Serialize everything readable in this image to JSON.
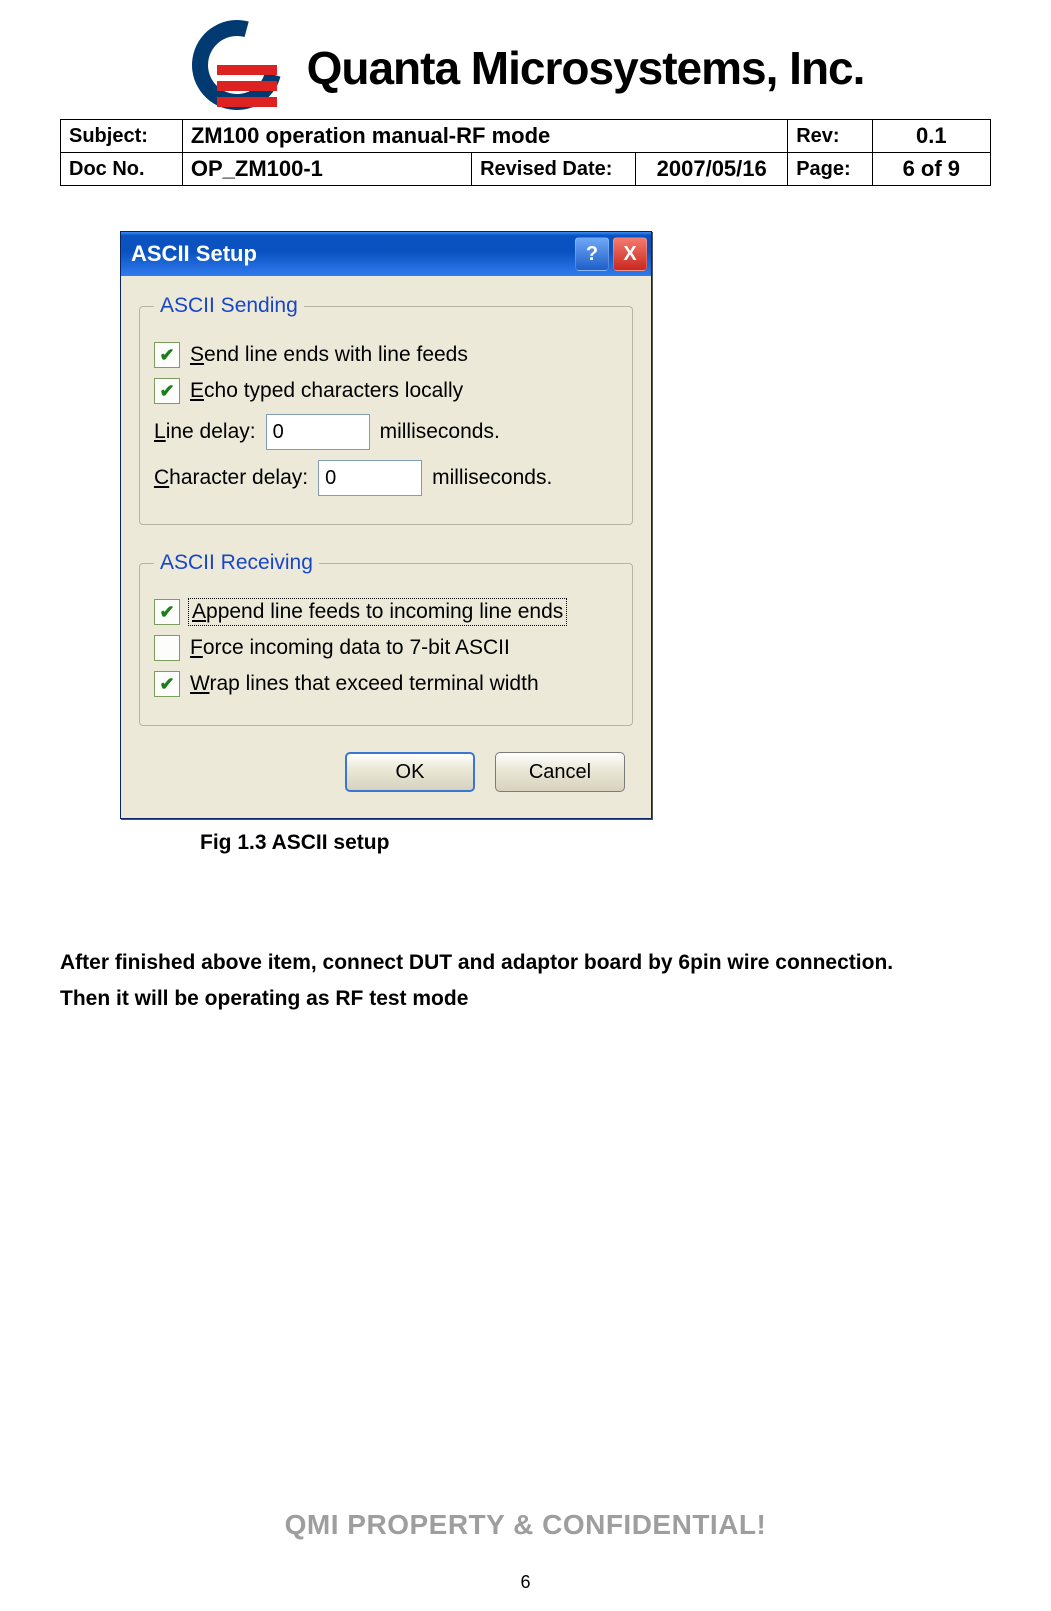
{
  "company": {
    "name": "Quanta Microsystems, Inc."
  },
  "header": {
    "subject_label": "Subject:",
    "subject_value": "ZM100 operation manual-RF mode",
    "rev_label": "Rev:",
    "rev_value": "0.1",
    "docno_label": "Doc No.",
    "docno_value": "OP_ZM100-1",
    "revdate_label": "Revised Date:",
    "revdate_value": "2007/05/16",
    "page_label": "Page:",
    "page_value": "6 of 9"
  },
  "dialog": {
    "title": "ASCII Setup",
    "help_glyph": "?",
    "close_glyph": "X",
    "sending": {
      "legend": "ASCII Sending",
      "send_line_ends": {
        "checked": true,
        "prefix": "S",
        "text": "end line ends with line feeds"
      },
      "echo_typed": {
        "checked": true,
        "prefix": "E",
        "text": "cho typed characters locally"
      },
      "line_delay_prefix": "L",
      "line_delay_label": "ine delay:",
      "line_delay_value": "0",
      "line_delay_suffix": "milliseconds.",
      "char_delay_prefix": "C",
      "char_delay_label": "haracter delay:",
      "char_delay_value": "0",
      "char_delay_suffix": "milliseconds."
    },
    "receiving": {
      "legend": "ASCII Receiving",
      "append_lf": {
        "checked": true,
        "prefix": "A",
        "text": "ppend line feeds to incoming line ends"
      },
      "force_7bit": {
        "checked": false,
        "prefix": "F",
        "text": "orce incoming data to 7-bit ASCII"
      },
      "wrap_lines": {
        "checked": true,
        "prefix": "W",
        "text": "rap lines that exceed terminal width"
      }
    },
    "ok_label": "OK",
    "cancel_label": "Cancel"
  },
  "figure_caption": "Fig 1.3 ASCII setup",
  "body_paragraph_line1": "After finished above item, connect DUT and adaptor board by 6pin wire connection.",
  "body_paragraph_line2": "Then it will be operating as RF test mode",
  "footer_confidential": "QMI PROPERTY & CONFIDENTIAL!",
  "footer_page_number": "6"
}
